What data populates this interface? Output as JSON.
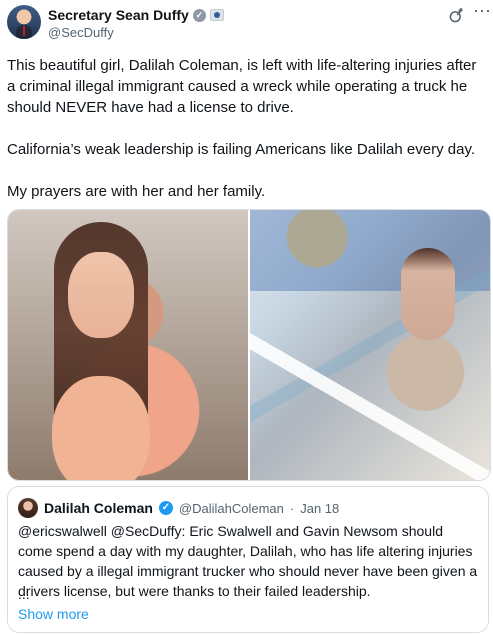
{
  "post": {
    "author_name": "Secretary Sean Duffy",
    "author_handle": "@SecDuffy",
    "paragraphs": [
      "This beautiful girl, Dalilah Coleman, is left with life-altering injuries after a criminal illegal immigrant caused a wreck while operating a truck he should NEVER have had a license to drive.",
      "California’s weak leadership is failing Americans like Dalilah every day.",
      "My prayers are with her and her family."
    ]
  },
  "icons": {
    "verified_badge": "verified-badge-icon",
    "government_badge": "government-badge-icon",
    "grok": "grok-icon",
    "more": "more-options-icon",
    "quote_verified": "verified-icon"
  },
  "media": [
    {
      "name": "girl-portrait-photo"
    },
    {
      "name": "hospital-bed-photo"
    }
  ],
  "quote": {
    "author_name": "Dalilah Coleman",
    "author_handle": "@DalilahColeman",
    "date": "Jan 18",
    "text": "@ericswalwell @SecDuffy: Eric Swalwell and Gavin Newsom should come spend a day with my daughter, Dalilah, who has life altering injuries caused by a illegal immigrant trucker who should never have been given a drivers license, but were thanks to their failed leadership.",
    "ellipsis": "...",
    "show_more": "Show more"
  },
  "colors": {
    "text_primary": "#0f1419",
    "text_secondary": "#536471",
    "accent_blue": "#1d9bf0",
    "border": "#d9dde0"
  }
}
